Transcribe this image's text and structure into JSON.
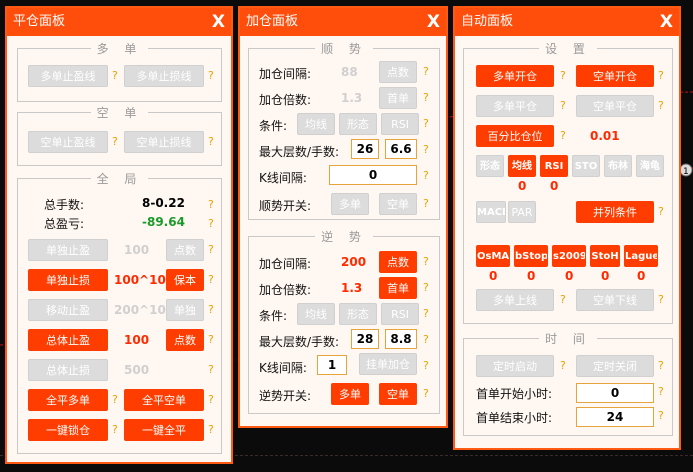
{
  "panel1": {
    "title": "平仓面板",
    "close": "X",
    "duo": {
      "title": "多 单",
      "btn1": "多单止盈线",
      "btn2": "多单止损线"
    },
    "kong": {
      "title": "空 单",
      "btn1": "空单止盈线",
      "btn2": "空单止损线"
    },
    "quanju": {
      "title": "全 局",
      "total_lots_label": "总手数:",
      "total_lots_value": "8-0.22",
      "total_pl_label": "总盈亏:",
      "total_pl_value": "-89.64",
      "single_tp_label": "单独止盈",
      "single_tp_value": "100",
      "points1": "点数",
      "single_sl_label": "单独止损",
      "single_sl_value": "100^10",
      "protect": "保本",
      "move_tp_label": "移动止盈",
      "move_tp_value": "200^100",
      "single2": "单独",
      "total_tp_label": "总体止盈",
      "total_tp_value": "100",
      "points2": "点数",
      "total_sl_label": "总体止损",
      "total_sl_value": "500",
      "close_all_buy": "全平多单",
      "close_all_sell": "全平空单",
      "lock": "一键锁仓",
      "close_all": "一键全平"
    }
  },
  "panel2": {
    "title": "加仓面板",
    "close": "X",
    "shun": {
      "title": "顺 势",
      "interval_label": "加仓间隔:",
      "interval_value": "88",
      "interval_btn": "点数",
      "mult_label": "加仓倍数:",
      "mult_value": "1.3",
      "mult_btn": "首单",
      "cond_label": "条件:",
      "cond1": "均线",
      "cond2": "形态",
      "cond3": "RSI",
      "max_label": "最大层数/手数:",
      "max_layers": "26",
      "max_lots": "6.6",
      "k_label": "K线间隔:",
      "k_value": "0",
      "switch_label": "顺势开关:",
      "sw_buy": "多单",
      "sw_sell": "空单"
    },
    "ni": {
      "title": "逆 势",
      "interval_label": "加仓间隔:",
      "interval_value": "200",
      "interval_btn": "点数",
      "mult_label": "加仓倍数:",
      "mult_value": "1.3",
      "mult_btn": "首单",
      "cond_label": "条件:",
      "cond1": "均线",
      "cond2": "形态",
      "cond3": "RSI",
      "max_label": "最大层数/手数:",
      "max_layers": "28",
      "max_lots": "8.8",
      "k_label": "K线间隔:",
      "k_value": "1",
      "k_btn": "挂单加仓",
      "switch_label": "逆势开关:",
      "sw_buy": "多单",
      "sw_sell": "空单"
    }
  },
  "panel3": {
    "title": "自动面板",
    "close": "X",
    "setting": {
      "title": "设 置",
      "open_buy": "多单开仓",
      "open_sell": "空单开仓",
      "close_buy": "多单平仓",
      "close_sell": "空单平仓",
      "pct": "百分比仓位",
      "pct_value": "0.01",
      "ind": [
        "形态",
        "均线",
        "RSI",
        "STO",
        "布林",
        "海龟"
      ],
      "ind_vals": [
        "0",
        "0"
      ],
      "macd": "MACD",
      "par": "PAR",
      "parallel": "并列条件",
      "sys": [
        "OsMA",
        "bStop",
        "s2009",
        "StoH",
        "Lague"
      ],
      "sys_vals": [
        "0",
        "0",
        "0",
        "0",
        "0"
      ],
      "up_line": "多单上线",
      "down_line": "空单下线"
    },
    "time": {
      "title": "时 间",
      "start": "定时启动",
      "stop": "定时关闭",
      "open_label": "首单开始小时:",
      "open_value": "0",
      "close_label": "首单结束小时:",
      "close_value": "24"
    }
  },
  "q": "?",
  "edge_badge": "1"
}
